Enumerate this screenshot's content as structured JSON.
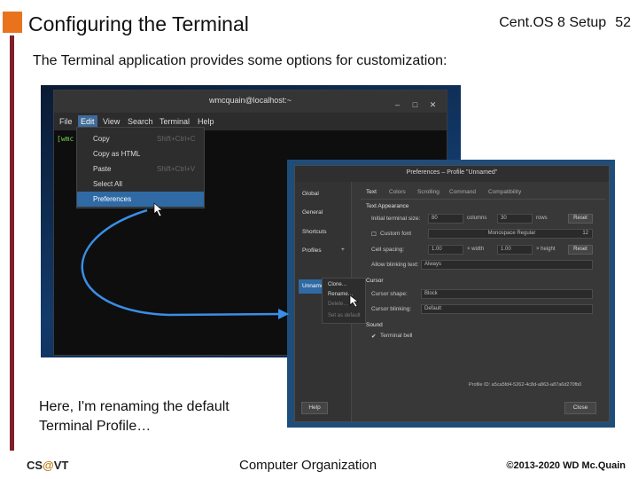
{
  "slide": {
    "title": "Configuring the Terminal",
    "series": "Cent.OS 8 Setup",
    "page_number": "52",
    "subtitle": "The Terminal application provides some options for customization:",
    "caption": "Here, I'm renaming the default Terminal Profile…"
  },
  "footer": {
    "left_prefix": "CS",
    "left_at": "@",
    "left_suffix": "VT",
    "center": "Computer Organization",
    "right": "©2013-2020 WD Mc.Quain"
  },
  "terminal": {
    "window_title": "wmcquain@localhost:~",
    "window_buttons": [
      "search-icon",
      "hamburger-icon",
      "minimize-icon",
      "maximize-icon",
      "close-icon"
    ],
    "prompt": "[wmc",
    "menubar": [
      "File",
      "Edit",
      "View",
      "Search",
      "Terminal",
      "Help"
    ],
    "active_menu": "Edit",
    "edit_menu": [
      {
        "label": "Copy",
        "shortcut": "Shift+Ctrl+C"
      },
      {
        "label": "Copy as HTML",
        "shortcut": ""
      },
      {
        "label": "Paste",
        "shortcut": "Shift+Ctrl+V"
      },
      {
        "label": "Select All",
        "shortcut": ""
      },
      {
        "label": "Preferences",
        "shortcut": ""
      }
    ]
  },
  "preferences": {
    "title": "Preferences – Profile \"Unnamed\"",
    "sidebar": {
      "global_header": "Global",
      "general": "General",
      "shortcuts": "Shortcuts",
      "profiles_header": "Profiles",
      "add": "+",
      "selected_profile": "Unnamed"
    },
    "tabs": [
      "Text",
      "Colors",
      "Scrolling",
      "Command",
      "Compatibility"
    ],
    "text_appearance": {
      "header": "Text Appearance",
      "initial_size_label": "Initial terminal size:",
      "columns_value": "80",
      "columns_label": "columns",
      "rows_value": "30",
      "rows_label": "rows",
      "reset_label": "Reset",
      "custom_font_label": "Custom font",
      "font_name": "Monospace Regular",
      "font_size": "12",
      "cell_spacing_label": "Cell spacing:",
      "width_value": "1.00",
      "width_label": "× width",
      "height_value": "1.00",
      "height_label": "× height",
      "blink_label": "Allow blinking text:",
      "blink_value": "Always"
    },
    "cursor": {
      "header": "Cursor",
      "shape_label": "Cursor shape:",
      "shape_value": "Block",
      "blinking_label": "Cursor blinking:",
      "blinking_value": "Default"
    },
    "sound": {
      "header": "Sound",
      "bell_label": "Terminal bell"
    },
    "profile_id": "Profile ID: a5ca5fd4-5262-4c8d-a863-a87a6d270fb0",
    "help_label": "Help",
    "close_label": "Close",
    "profile_menu": [
      {
        "label": "Clone…",
        "enabled": true
      },
      {
        "label": "Rename…",
        "enabled": true
      },
      {
        "label": "Delete…",
        "enabled": false
      },
      {
        "label": "Set as default",
        "enabled": false
      }
    ]
  },
  "colors": {
    "title_square": "#e9731c",
    "left_bar": "#7f1f2a",
    "arrow": "#3a8ee6",
    "selection": "#2f6aa5"
  }
}
